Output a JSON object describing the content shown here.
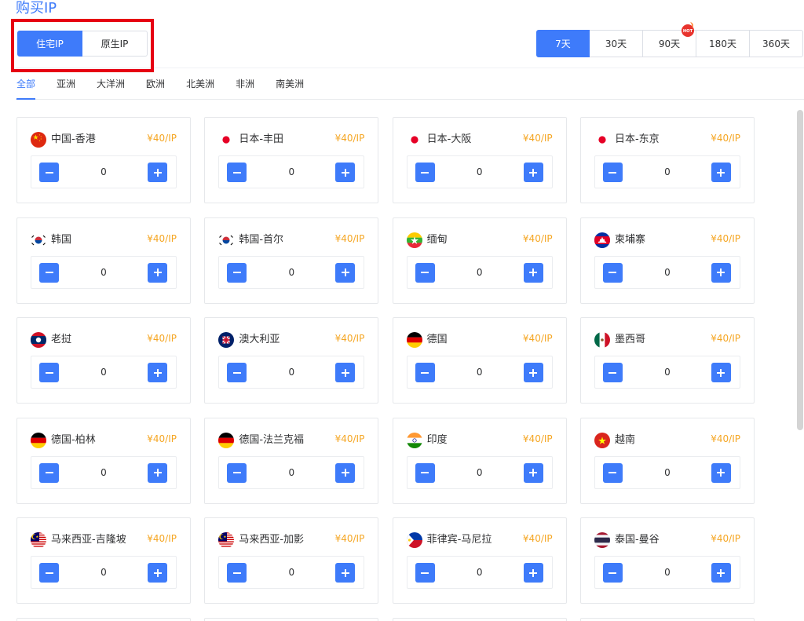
{
  "page": {
    "title": "购买IP"
  },
  "ip_type": {
    "options": [
      {
        "label": "住宅IP",
        "active": true
      },
      {
        "label": "原生IP",
        "active": false
      }
    ]
  },
  "durations": {
    "options": [
      {
        "label": "7天",
        "active": true
      },
      {
        "label": "30天",
        "active": false
      },
      {
        "label": "90天",
        "active": false,
        "badge": "HOT"
      },
      {
        "label": "180天",
        "active": false
      },
      {
        "label": "360天",
        "active": false
      }
    ]
  },
  "regions": {
    "tabs": [
      {
        "label": "全部",
        "active": true
      },
      {
        "label": "亚洲",
        "active": false
      },
      {
        "label": "大洋洲",
        "active": false
      },
      {
        "label": "欧洲",
        "active": false
      },
      {
        "label": "北美洲",
        "active": false
      },
      {
        "label": "非洲",
        "active": false
      },
      {
        "label": "南美洲",
        "active": false
      }
    ]
  },
  "stepper": {
    "decrease_icon": "minus-icon",
    "increase_icon": "plus-icon"
  },
  "cards": [
    {
      "name": "中国-香港",
      "flag": "flag-cn",
      "price": "¥40/IP",
      "quantity": 0
    },
    {
      "name": "日本-丰田",
      "flag": "flag-jp",
      "price": "¥40/IP",
      "quantity": 0
    },
    {
      "name": "日本-大阪",
      "flag": "flag-jp",
      "price": "¥40/IP",
      "quantity": 0
    },
    {
      "name": "日本-东京",
      "flag": "flag-jp",
      "price": "¥40/IP",
      "quantity": 0
    },
    {
      "name": "韩国",
      "flag": "flag-kr",
      "price": "¥40/IP",
      "quantity": 0
    },
    {
      "name": "韩国-首尔",
      "flag": "flag-kr",
      "price": "¥40/IP",
      "quantity": 0
    },
    {
      "name": "缅甸",
      "flag": "flag-mm",
      "price": "¥40/IP",
      "quantity": 0
    },
    {
      "name": "柬埔寨",
      "flag": "flag-kh",
      "price": "¥40/IP",
      "quantity": 0
    },
    {
      "name": "老挝",
      "flag": "flag-la",
      "price": "¥40/IP",
      "quantity": 0
    },
    {
      "name": "澳大利亚",
      "flag": "flag-au",
      "price": "¥40/IP",
      "quantity": 0
    },
    {
      "name": "德国",
      "flag": "flag-de",
      "price": "¥40/IP",
      "quantity": 0
    },
    {
      "name": "墨西哥",
      "flag": "flag-mx",
      "price": "¥40/IP",
      "quantity": 0
    },
    {
      "name": "德国-柏林",
      "flag": "flag-de",
      "price": "¥40/IP",
      "quantity": 0
    },
    {
      "name": "德国-法兰克福",
      "flag": "flag-de",
      "price": "¥40/IP",
      "quantity": 0
    },
    {
      "name": "印度",
      "flag": "flag-in",
      "price": "¥40/IP",
      "quantity": 0
    },
    {
      "name": "越南",
      "flag": "flag-vn",
      "price": "¥40/IP",
      "quantity": 0
    },
    {
      "name": "马来西亚-吉隆坡",
      "flag": "flag-my",
      "price": "¥40/IP",
      "quantity": 0
    },
    {
      "name": "马来西亚-加影",
      "flag": "flag-my",
      "price": "¥40/IP",
      "quantity": 0
    },
    {
      "name": "菲律宾-马尼拉",
      "flag": "flag-ph",
      "price": "¥40/IP",
      "quantity": 0
    },
    {
      "name": "泰国-曼谷",
      "flag": "flag-th",
      "price": "¥40/IP",
      "quantity": 0
    }
  ],
  "colors": {
    "accent": "#3e7bfa",
    "price": "#f5a623",
    "highlight": "#e60012",
    "hot_badge": "#e8342e"
  }
}
